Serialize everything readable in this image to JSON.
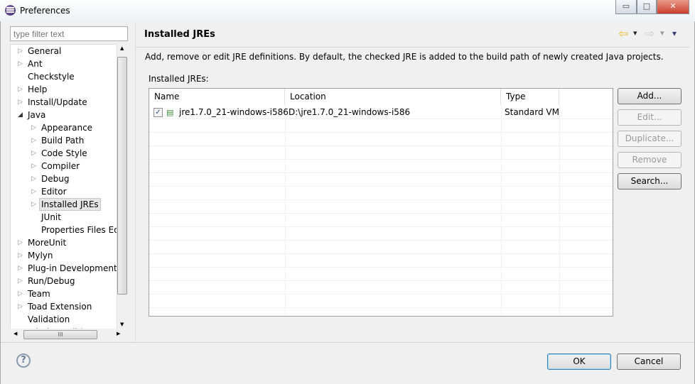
{
  "window": {
    "title": "Preferences",
    "minimize": "▭",
    "maximize": "□",
    "close": "✕"
  },
  "filter": {
    "placeholder": "type filter text"
  },
  "tree": [
    {
      "label": "General",
      "level": 0,
      "arrow": "▷"
    },
    {
      "label": "Ant",
      "level": 0,
      "arrow": "▷"
    },
    {
      "label": "Checkstyle",
      "level": 0,
      "arrow": ""
    },
    {
      "label": "Help",
      "level": 0,
      "arrow": "▷"
    },
    {
      "label": "Install/Update",
      "level": 0,
      "arrow": "▷"
    },
    {
      "label": "Java",
      "level": 0,
      "arrow": "◢"
    },
    {
      "label": "Appearance",
      "level": 1,
      "arrow": "▷"
    },
    {
      "label": "Build Path",
      "level": 1,
      "arrow": "▷"
    },
    {
      "label": "Code Style",
      "level": 1,
      "arrow": "▷"
    },
    {
      "label": "Compiler",
      "level": 1,
      "arrow": "▷"
    },
    {
      "label": "Debug",
      "level": 1,
      "arrow": "▷"
    },
    {
      "label": "Editor",
      "level": 1,
      "arrow": "▷"
    },
    {
      "label": "Installed JREs",
      "level": 1,
      "arrow": "▷",
      "selected": true
    },
    {
      "label": "JUnit",
      "level": 1,
      "arrow": ""
    },
    {
      "label": "Properties Files Editor",
      "level": 1,
      "arrow": ""
    },
    {
      "label": "MoreUnit",
      "level": 0,
      "arrow": "▷"
    },
    {
      "label": "Mylyn",
      "level": 0,
      "arrow": "▷"
    },
    {
      "label": "Plug-in Development",
      "level": 0,
      "arrow": "▷"
    },
    {
      "label": "Run/Debug",
      "level": 0,
      "arrow": "▷"
    },
    {
      "label": "Team",
      "level": 0,
      "arrow": "▷"
    },
    {
      "label": "Toad Extension",
      "level": 0,
      "arrow": "▷"
    },
    {
      "label": "Validation",
      "level": 0,
      "arrow": ""
    },
    {
      "label": "WindowBuilder",
      "level": 0,
      "arrow": "▷"
    }
  ],
  "page": {
    "title": "Installed JREs",
    "description": "Add, remove or edit JRE definitions. By default, the checked JRE is added to the build path of newly created Java projects.",
    "list_label": "Installed JREs:",
    "columns": [
      "Name",
      "Location",
      "Type"
    ],
    "rows": [
      {
        "checked": true,
        "name": "jre1.7.0_21-windows-i586",
        "location": "D:\\jre1.7.0_21-windows-i586",
        "type": "Standard VM"
      }
    ],
    "buttons": {
      "add": "Add...",
      "edit": "Edit...",
      "duplicate": "Duplicate...",
      "remove": "Remove",
      "search": "Search..."
    }
  },
  "footer": {
    "help": "?",
    "ok": "OK",
    "cancel": "Cancel"
  },
  "nav": {
    "back": "⇦",
    "forward": "⇨",
    "dropdown": "▾"
  },
  "colors": {
    "back_arrow": "#e8b830",
    "selection": "#e6e6e6",
    "close": "#c9402d"
  }
}
